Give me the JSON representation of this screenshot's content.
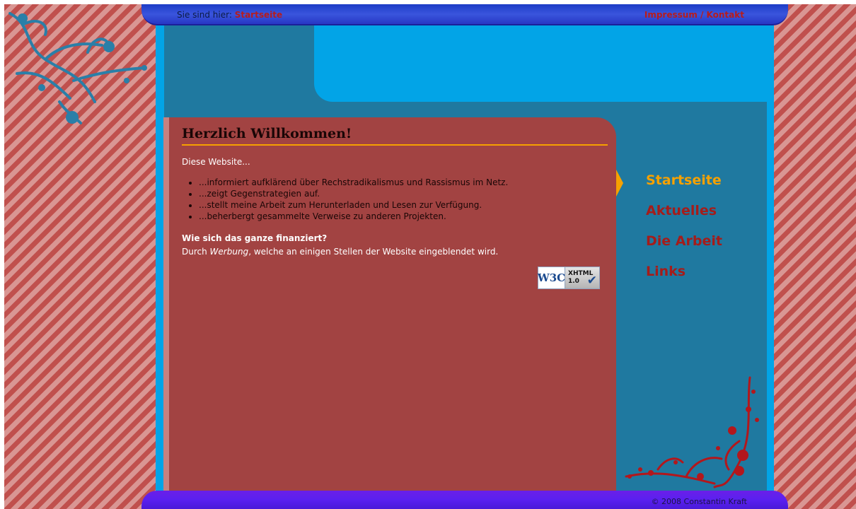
{
  "topbar": {
    "breadcrumb_prefix": "Sie sind hier:",
    "breadcrumb_current": "Startseite",
    "impressum_link": "Impressum / Kontakt"
  },
  "content": {
    "title": "Herzlich Willkommen!",
    "intro": "Diese Website...",
    "bullets": [
      "...informiert aufklärend über Rechstradikalismus und Rassismus im Netz.",
      "...zeigt Gegenstrategien auf.",
      "...stellt meine Arbeit zum Herunterladen und Lesen zur Verfügung.",
      "...beherbergt gesammelte Verweise zu anderen Projekten."
    ],
    "subheading": "Wie sich das ganze finanziert?",
    "finance_prefix": "Durch ",
    "finance_emphasis": "Werbung",
    "finance_suffix": ", welche an einigen Stellen der Website eingeblendet wird.",
    "badge": {
      "logo": "W3C",
      "line1": "XHTML",
      "line2": "1.0"
    }
  },
  "nav": {
    "items": [
      {
        "label": "Startseite",
        "active": true
      },
      {
        "label": "Aktuelles",
        "active": false
      },
      {
        "label": "Die Arbeit",
        "active": false
      },
      {
        "label": "Links",
        "active": false
      }
    ]
  },
  "footer": {
    "copyright": "© 2008 Constantin Kraft"
  },
  "colors": {
    "accent": "#f6a100",
    "link_red": "#a51c1a",
    "content_bg": "#a24342",
    "frame_blue": "#02a4e7",
    "inner_blue": "#1f79a0",
    "bar_blue": "#1d3cc6",
    "footer_purple": "#5a20f0",
    "stripe_dark": "#c0504d",
    "stripe_light": "#d99693"
  },
  "icons": [
    "floral-ornament-icon",
    "flower-ornament-icon",
    "w3c-xhtml-badge-icon",
    "nav-arrow-icon"
  ]
}
